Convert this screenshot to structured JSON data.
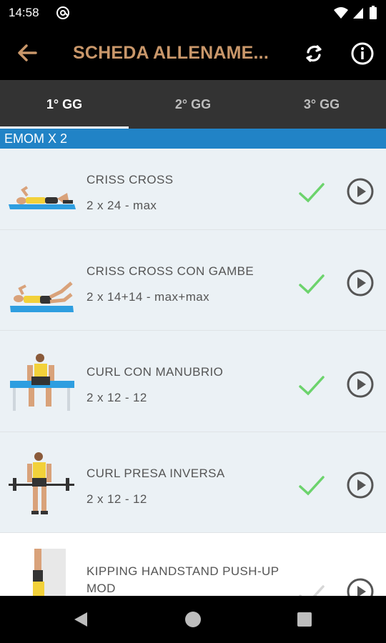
{
  "status_bar": {
    "time": "14:58"
  },
  "app_bar": {
    "title": "SCHEDA ALLENAME..."
  },
  "tabs": [
    {
      "label": "1° GG",
      "active": true
    },
    {
      "label": "2° GG",
      "active": false
    },
    {
      "label": "3° GG",
      "active": false
    }
  ],
  "section": {
    "title": "EMOM X 2"
  },
  "exercises": [
    {
      "name": "CRISS CROSS",
      "reps": "2 x 24 - max",
      "done": true,
      "image": "criss-cross-figure"
    },
    {
      "name": "CRISS CROSS CON GAMBE",
      "reps": "2 x 14+14 - max+max",
      "done": true,
      "image": "criss-cross-legs-figure"
    },
    {
      "name": "CURL CON MANUBRIO",
      "reps": "2 x 12 - 12",
      "done": true,
      "image": "dumbbell-curl-figure"
    },
    {
      "name": "CURL PRESA INVERSA",
      "reps": "2 x 12 - 12",
      "done": true,
      "image": "reverse-grip-curl-figure"
    },
    {
      "name": "KIPPING HANDSTAND PUSH-UP MOD",
      "reps": "",
      "done": false,
      "image": "handstand-pushup-figure"
    }
  ],
  "colors": {
    "title": "#c9976a",
    "section_header": "#2183c6",
    "check_done": "#6cd36c",
    "check_pending": "#d6d6d6",
    "row_blue": "#ebf1f5"
  }
}
